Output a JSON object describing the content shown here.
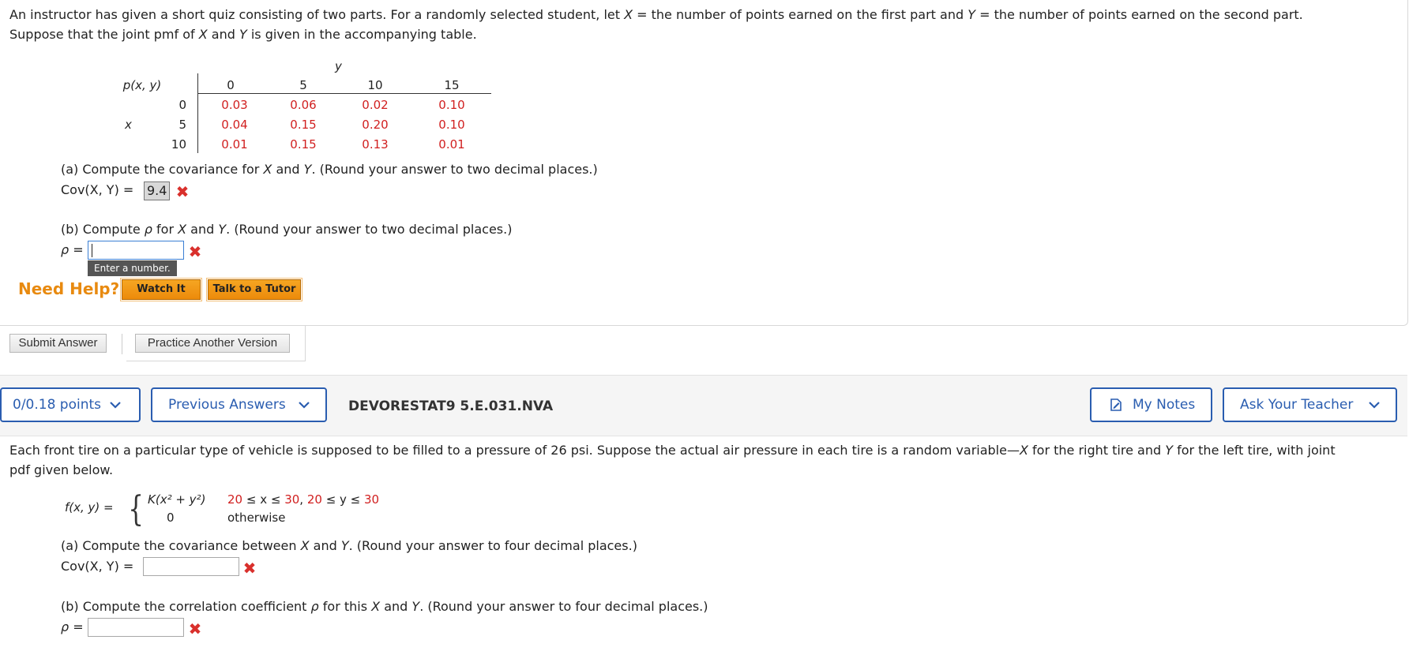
{
  "question1": {
    "intro_line1_a": "An instructor has given a short quiz consisting of two parts. For a randomly selected student, let ",
    "var_x": "X",
    "intro_line1_b": " = the number of points earned on the first part and ",
    "var_y": "Y",
    "intro_line1_c": " = the number of points earned on the second part.",
    "intro_line2_a": "Suppose that the joint pmf of ",
    "intro_line2_b": " and ",
    "intro_line2_c": " is given in the accompanying table.",
    "table": {
      "corner_label": "p(x, y)",
      "y_label": "y",
      "x_label": "x",
      "y_values": [
        "0",
        "5",
        "10",
        "15"
      ],
      "x_values": [
        "0",
        "5",
        "10"
      ],
      "rows": [
        [
          "0.03",
          "0.06",
          "0.02",
          "0.10"
        ],
        [
          "0.04",
          "0.15",
          "0.20",
          "0.10"
        ],
        [
          "0.01",
          "0.15",
          "0.13",
          "0.01"
        ]
      ]
    },
    "part_a_prompt_a": "(a) Compute the covariance for ",
    "part_a_prompt_b": " and ",
    "part_a_prompt_c": ". (Round your answer to two decimal places.)",
    "part_a_label": "Cov(X, Y) =",
    "part_a_answer": "9.4",
    "part_b_prompt_a": "(b) Compute ",
    "rho": "ρ",
    "part_b_prompt_b": " for ",
    "part_b_prompt_c": " and ",
    "part_b_prompt_d": ". (Round your answer to two decimal places.)",
    "part_b_label": "ρ =",
    "part_b_answer": "",
    "tooltip": "Enter a number.",
    "need_help": "Need Help?",
    "watch_it": "Watch It",
    "talk_to_tutor": "Talk to a Tutor",
    "submit_answer": "Submit Answer",
    "practice_another": "Practice Another Version"
  },
  "header": {
    "points": "0/0.18 points",
    "previous_answers": "Previous Answers",
    "question_id": "DEVORESTAT9 5.E.031.NVA",
    "my_notes": "My Notes",
    "ask_teacher": "Ask Your Teacher",
    "accent_color": "#2a5db0"
  },
  "question2": {
    "intro_a": "Each front tire on a particular type of vehicle is supposed to be filled to a pressure of 26 psi. Suppose the actual air pressure in each tire is a random variable—",
    "intro_x": "X",
    "intro_b": " for the right tire and ",
    "intro_y": "Y",
    "intro_c": " for the left tire, with joint",
    "intro_line2": "pdf given below.",
    "pdf_label": "f(x, y) =",
    "case1_expr": "K(x² + y²)",
    "case1_cond_a": "20",
    "case1_cond_b": " ≤ x ≤ ",
    "case1_cond_c": "30",
    "case1_cond_d": ", ",
    "case1_cond_e": "20",
    "case1_cond_f": " ≤ y ≤ ",
    "case1_cond_g": "30",
    "case2_expr": "0",
    "case2_cond": "otherwise",
    "part_a_prompt_a": "(a) Compute the covariance between ",
    "part_a_prompt_b": " and ",
    "part_a_prompt_c": ". (Round your answer to four decimal places.)",
    "part_a_label": "Cov(X, Y) =",
    "part_a_answer": "",
    "part_b_prompt_a": "(b) Compute the correlation coefficient ",
    "part_b_prompt_b": " for this ",
    "part_b_prompt_c": " and ",
    "part_b_prompt_d": ". (Round your answer to four decimal places.)",
    "part_b_label": "ρ =",
    "part_b_answer": ""
  }
}
